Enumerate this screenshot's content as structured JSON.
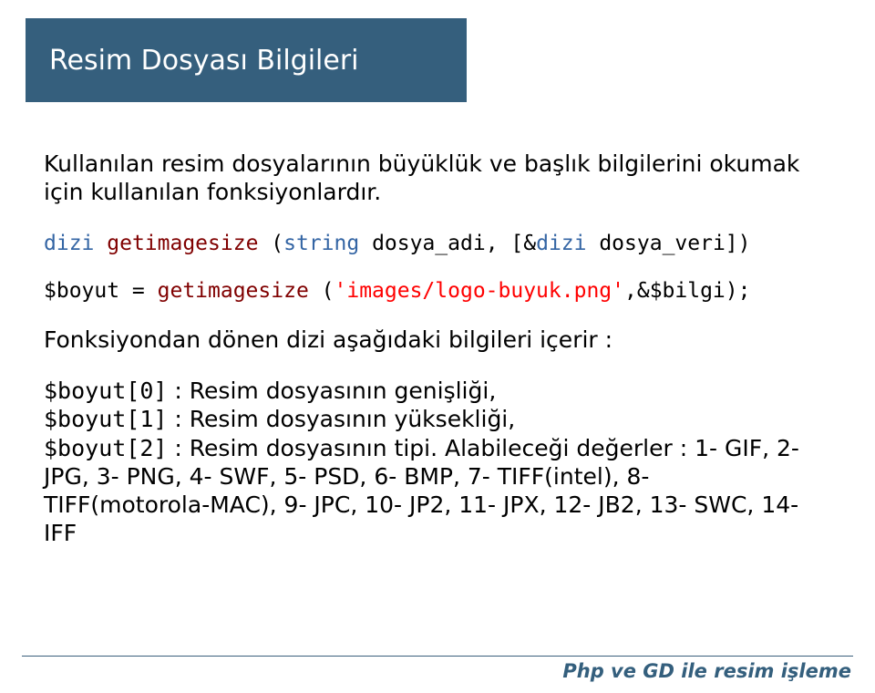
{
  "title": "Resim Dosyası Bilgileri",
  "intro": "Kullanılan resim dosyalarının büyüklük ve başlık bilgilerini okumak için kullanılan fonksiyonlardır.",
  "sig": {
    "kw1": "dizi",
    "fn": "getimagesize",
    "paren_open": " (",
    "kw2": "string",
    "arg1": " dosya_adi, [&",
    "kw3": "dizi",
    "arg2": " dosya_veri])"
  },
  "call": {
    "lhs": "$boyut = ",
    "fn": "getimagesize",
    "paren": " (",
    "str": "'images/logo-buyuk.png'",
    "rest": ",&$bilgi);"
  },
  "desc": "Fonksiyondan dönen dizi aşağıdaki bilgileri içerir :",
  "items": {
    "a_code": "$boyut[0]",
    "a_text": ": Resim dosyasının genişliği,",
    "b_code": "$boyut[1]",
    "b_text": ": Resim dosyasının yüksekliği,",
    "c_code": "$boyut[2]",
    "c_text": ": Resim dosyasının tipi. Alabileceği değerler : 1- GIF, 2- JPG, 3- PNG, 4- SWF, 5- PSD, 6- BMP, 7- TIFF(intel), 8- TIFF(motorola-MAC), 9- JPC, 10- JP2, 11- JPX, 12- JB2, 13- SWC, 14- IFF"
  },
  "footer": "Php ve GD ile resim işleme"
}
